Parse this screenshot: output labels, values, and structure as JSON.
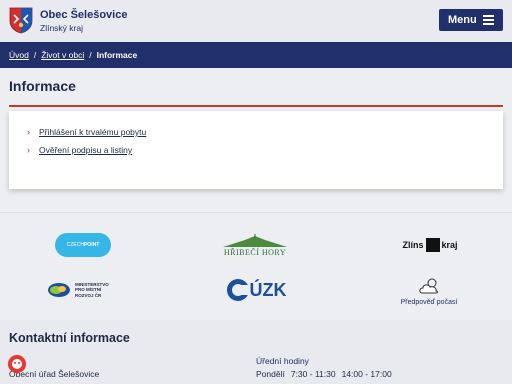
{
  "header": {
    "title": "Obec Šelešovice",
    "subtitle": "Zlínský kraj",
    "menu_label": "Menu"
  },
  "breadcrumb": {
    "items": [
      "Úvod",
      "Život v obci",
      "Informace"
    ]
  },
  "page": {
    "title": "Informace"
  },
  "links": [
    "Přihlášení k trvalému pobytu",
    "Ověření podpisu a listiny"
  ],
  "partners": {
    "czech_point_a": "CZECH",
    "czech_point_b": "POINT",
    "hribeci": "HŘIBEČÍ HORY",
    "zlinsky_a": "Zlíns",
    "zlinsky_b": "kraj",
    "mmr": [
      "MINISTERSTVO",
      "PRO MÍSTNÍ",
      "ROZVOJ ČR"
    ],
    "cuzk": "ÚZK",
    "pocasi": "Předpověď počasí"
  },
  "contact": {
    "title": "Kontaktní informace",
    "address_label": "sa",
    "address_value": "Obecní úřad Šelešovice",
    "hours_label": "Úřední hodiny",
    "hours_day": "Pondělí",
    "hours_slot1": "7:30 - 11:30",
    "hours_slot2": "14:00 - 17:00"
  },
  "colors": {
    "navy": "#21306a",
    "accent_red": "#c0392b",
    "czech_point_blue": "#35b6e6"
  }
}
